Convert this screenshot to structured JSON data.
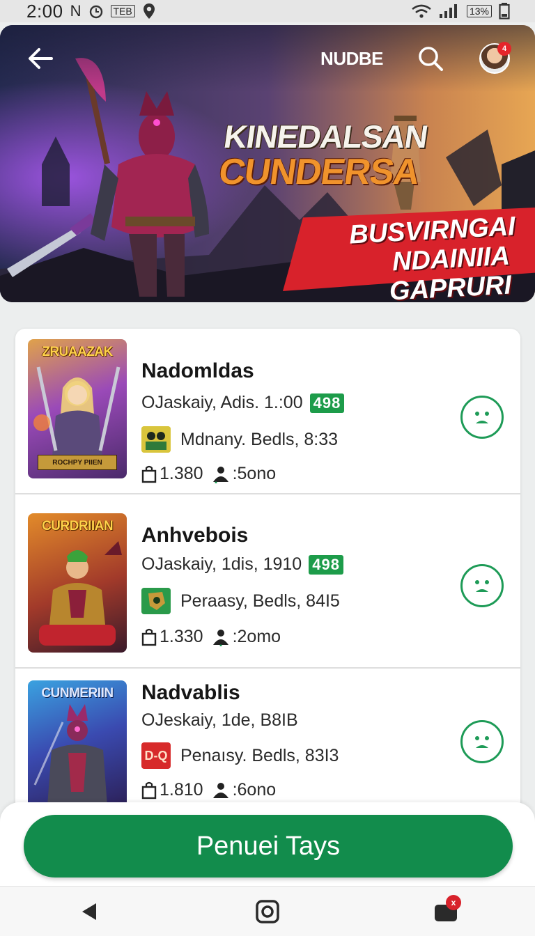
{
  "status_bar": {
    "time": "2:00",
    "carrier_glyph": "N",
    "box_label": "TEB",
    "battery": "13%"
  },
  "header": {
    "brand": "NUDBE",
    "back_icon": "arrow-left-icon",
    "search_icon": "search-icon",
    "notification_count": "4"
  },
  "hero": {
    "title_line_1": "KINEDALSAN",
    "title_line_2": "CUNDERSA",
    "ribbon_line_1": "BUSVIRNGAI",
    "ribbon_line_2": "NDAINIIA GAPRURI"
  },
  "games": [
    {
      "name": "Nadomldas",
      "meta": "OJaskaiy, Adis. 1.:00",
      "score": "498",
      "developer": "Mdnany. Bedls, 8:33",
      "downloads": "1.380",
      "players": ":5ono",
      "thumb_title": "ZRUAAZAK",
      "thumb_caption": "ROCHPY PIIEN",
      "theme": "#8a4aa8"
    },
    {
      "name": "Anhvebois",
      "meta": "OJaskaiy, 1dis, 1910",
      "score": "498",
      "developer": "Peraasy, Bedls, 84I5",
      "downloads": "1.330",
      "players": ":2omo",
      "thumb_title": "CURDRIIAN",
      "thumb_caption": "",
      "theme": "#c1562a"
    },
    {
      "name": "Nadvablis",
      "meta": "OJeskaiy, 1de, B8IB",
      "score": "",
      "developer": "Penaısy. Bedls, 83I3",
      "downloads": "1.810",
      "players": ":6ono",
      "thumb_title": "CUNMERIIN",
      "thumb_caption": "",
      "theme": "#3a62b0"
    }
  ],
  "dev_icon_3_label": "D-Q",
  "cta": {
    "label": "Penuei Tays",
    "color": "#128c4c"
  },
  "nav": {
    "back_icon": "nav-back-icon",
    "home_icon": "nav-home-icon",
    "recents_icon": "nav-recents-icon",
    "badge": "x"
  },
  "colors": {
    "accent_green": "#1e9b57",
    "score_green": "#1d9c4a",
    "ribbon_red": "#d8222b"
  }
}
